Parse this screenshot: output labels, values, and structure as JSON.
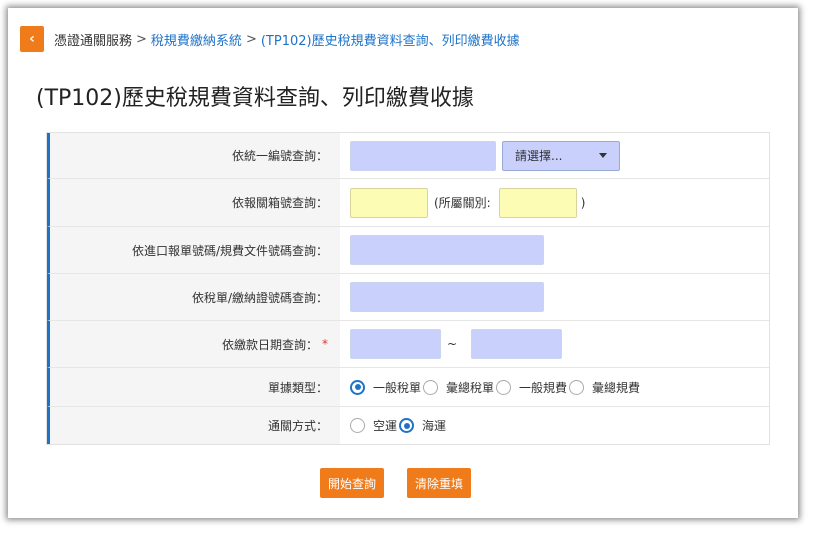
{
  "breadcrumb": {
    "back_icon": "chevron-left-icon",
    "items": [
      "憑證通關服務",
      "稅規費繳納系統",
      "(TP102)歷史稅規費資料查詢、列印繳費收據"
    ],
    "separator": ">"
  },
  "page_title": "(TP102)歷史稅規費資料查詢、列印繳費收據",
  "form": {
    "rows": [
      {
        "label": "依統一編號查詢："
      },
      {
        "label": "依報關箱號查詢："
      },
      {
        "label": "依進口報單號碼/規費文件號碼查詢："
      },
      {
        "label": "依稅單/繳納證號碼查詢："
      },
      {
        "label": "依繳款日期查詢：",
        "required": "*"
      },
      {
        "label": "單據類型："
      },
      {
        "label": "通關方式："
      }
    ],
    "select_placeholder": "請選擇...",
    "customs_prefix": "(所屬關別:",
    "customs_suffix": ")",
    "date_separator": "~",
    "doc_types": [
      {
        "label": "一般稅單",
        "checked": true
      },
      {
        "label": "彙總稅單",
        "checked": false
      },
      {
        "label": "一般規費",
        "checked": false
      },
      {
        "label": "彙總規費",
        "checked": false
      }
    ],
    "transport": [
      {
        "label": "空運",
        "checked": false
      },
      {
        "label": "海運",
        "checked": true
      }
    ]
  },
  "buttons": {
    "query": "開始查詢",
    "reset": "清除重填"
  },
  "colors": {
    "accent": "#f07b1b",
    "link": "#1e73c8",
    "input": "#c8d0fb",
    "input_yellow": "#fcfcb4"
  }
}
